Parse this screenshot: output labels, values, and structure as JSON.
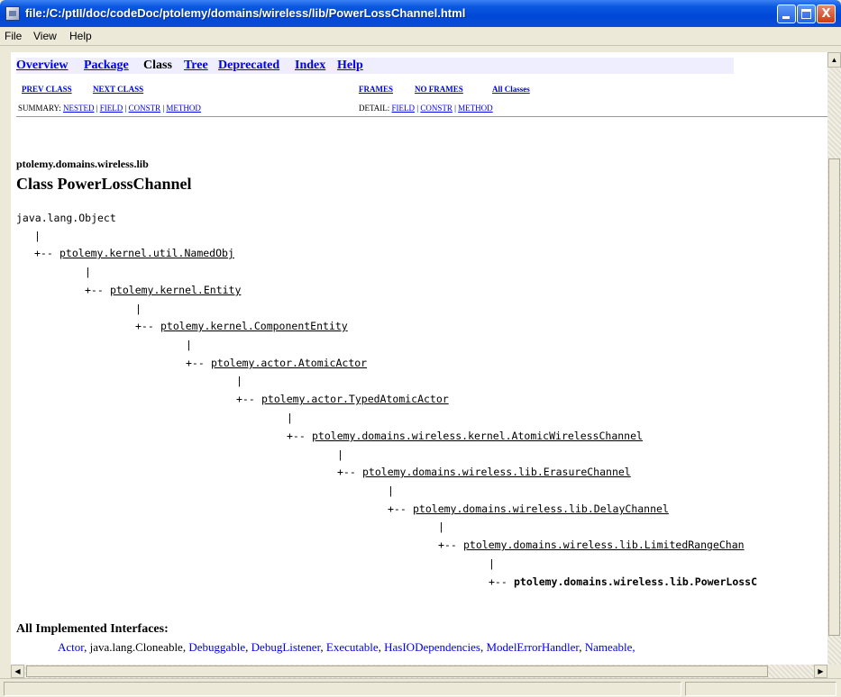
{
  "window": {
    "title": "file:/C:/ptII/doc/codeDoc/ptolemy/domains/wireless/lib/PowerLossChannel.html",
    "controls": {
      "min": "",
      "max": "",
      "close": "X"
    }
  },
  "menu": [
    "File",
    "View",
    "Help"
  ],
  "nav": {
    "overview": "Overview",
    "package": "Package",
    "class": "Class",
    "tree": "Tree",
    "deprecated": "Deprecated",
    "index": "Index",
    "help": "Help",
    "prev_class": "PREV CLASS",
    "next_class": "NEXT CLASS",
    "frames": "FRAMES",
    "no_frames": "NO FRAMES",
    "all_classes": "All Classes",
    "summary_label": "SUMMARY:",
    "summary_links": [
      "NESTED",
      "FIELD",
      "CONSTR",
      "METHOD"
    ],
    "detail_label": "DETAIL:",
    "detail_links": [
      "FIELD",
      "CONSTR",
      "METHOD"
    ],
    "sep": "|"
  },
  "doc": {
    "package": "ptolemy.domains.wireless.lib",
    "class_title": "Class PowerLossChannel",
    "tree_root": "java.lang.Object",
    "pipe": "|",
    "branch": "+--",
    "hierarchy": [
      "ptolemy.kernel.util.NamedObj",
      "ptolemy.kernel.Entity",
      "ptolemy.kernel.ComponentEntity",
      "ptolemy.actor.AtomicActor",
      "ptolemy.actor.TypedAtomicActor",
      "ptolemy.domains.wireless.kernel.AtomicWirelessChannel",
      "ptolemy.domains.wireless.lib.ErasureChannel",
      "ptolemy.domains.wireless.lib.DelayChannel",
      "ptolemy.domains.wireless.lib.LimitedRangeChan",
      "ptolemy.domains.wireless.lib.PowerLossC"
    ],
    "implemented_heading": "All Implemented Interfaces:",
    "interfaces": [
      "Actor",
      "java.lang.Cloneable",
      "Debuggable",
      "DebugListener",
      "Executable",
      "HasIODependencies",
      "ModelErrorHandler",
      "Nameable,"
    ],
    "interface_linked": [
      true,
      false,
      true,
      true,
      true,
      true,
      true,
      true
    ]
  },
  "scroll": {
    "up": "▲",
    "left": "◀",
    "right": "▶"
  },
  "colors": {
    "link": "#0000ee",
    "navbar_bg": "#eeeeff",
    "titlebar": "#0a58e0"
  }
}
